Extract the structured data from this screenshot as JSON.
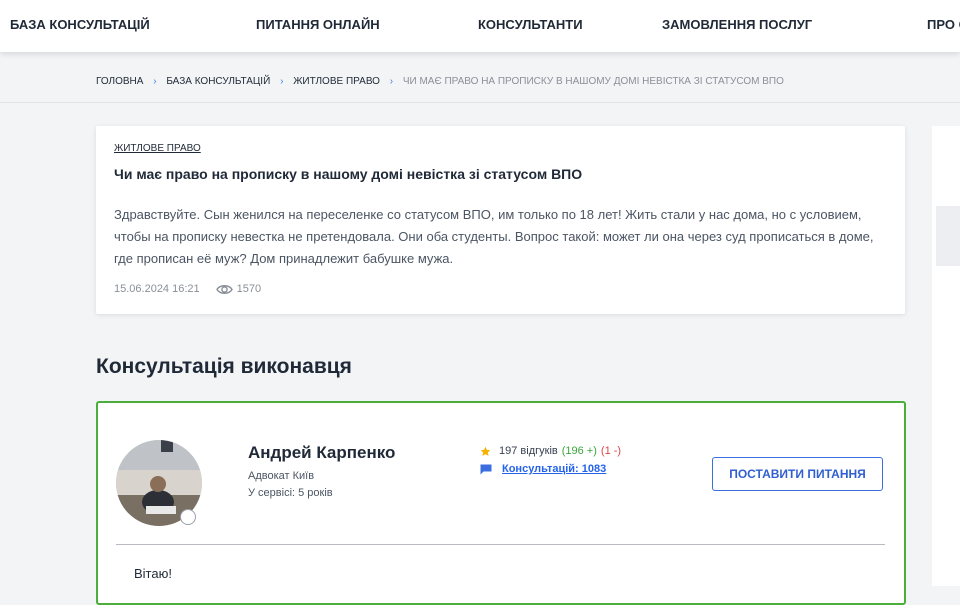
{
  "nav": {
    "items": [
      "БАЗА КОНСУЛЬТАЦІЙ",
      "ПИТАННЯ ОНЛАЙН",
      "КОНСУЛЬТАНТИ",
      "ЗАМОВЛЕННЯ ПОСЛУГ",
      "ПРО С"
    ]
  },
  "breadcrumb": {
    "items": [
      "ГОЛОВНА",
      "БАЗА КОНСУЛЬТАЦІЙ",
      "ЖИТЛОВЕ ПРАВО"
    ],
    "current": "ЧИ МАЄ ПРАВО НА ПРОПИСКУ В НАШОМУ ДОМІ НЕВІСТКА ЗІ СТАТУСОМ ВПО"
  },
  "question": {
    "category": "ЖИТЛОВЕ ПРАВО",
    "title": "Чи має право на прописку в нашому домі невістка зі статусом ВПО",
    "body": "Здравствуйте. Сын женился на переселенке со статусом ВПО, им только по 18 лет! Жить стали у нас дома, но с условием, чтобы на прописку невестка не претендовала. Они оба студенты. Вопрос такой: может ли она через суд прописаться в доме, где прописан её муж? Дом принадлежит бабушке мужа.",
    "date": "15.06.2024 16:21",
    "views": "1570"
  },
  "section": {
    "title": "Консультація виконавця"
  },
  "expert": {
    "name": "Андрей Карпенко",
    "role": "Адвокат Київ",
    "service": "У сервісі: 5 років",
    "reviews": "197 відгуків",
    "positive": "(196 +)",
    "negative": "(1 -)",
    "consultations": "Консультацій: 1083",
    "ask_button": "ПОСТАВИТИ ПИТАННЯ",
    "greeting": "Вітаю!"
  },
  "colors": {
    "accent_blue": "#3b6fe0",
    "card_border_green": "#4cae3a",
    "star": "#f5b301",
    "positive": "#3aa63a",
    "negative": "#e04545"
  }
}
